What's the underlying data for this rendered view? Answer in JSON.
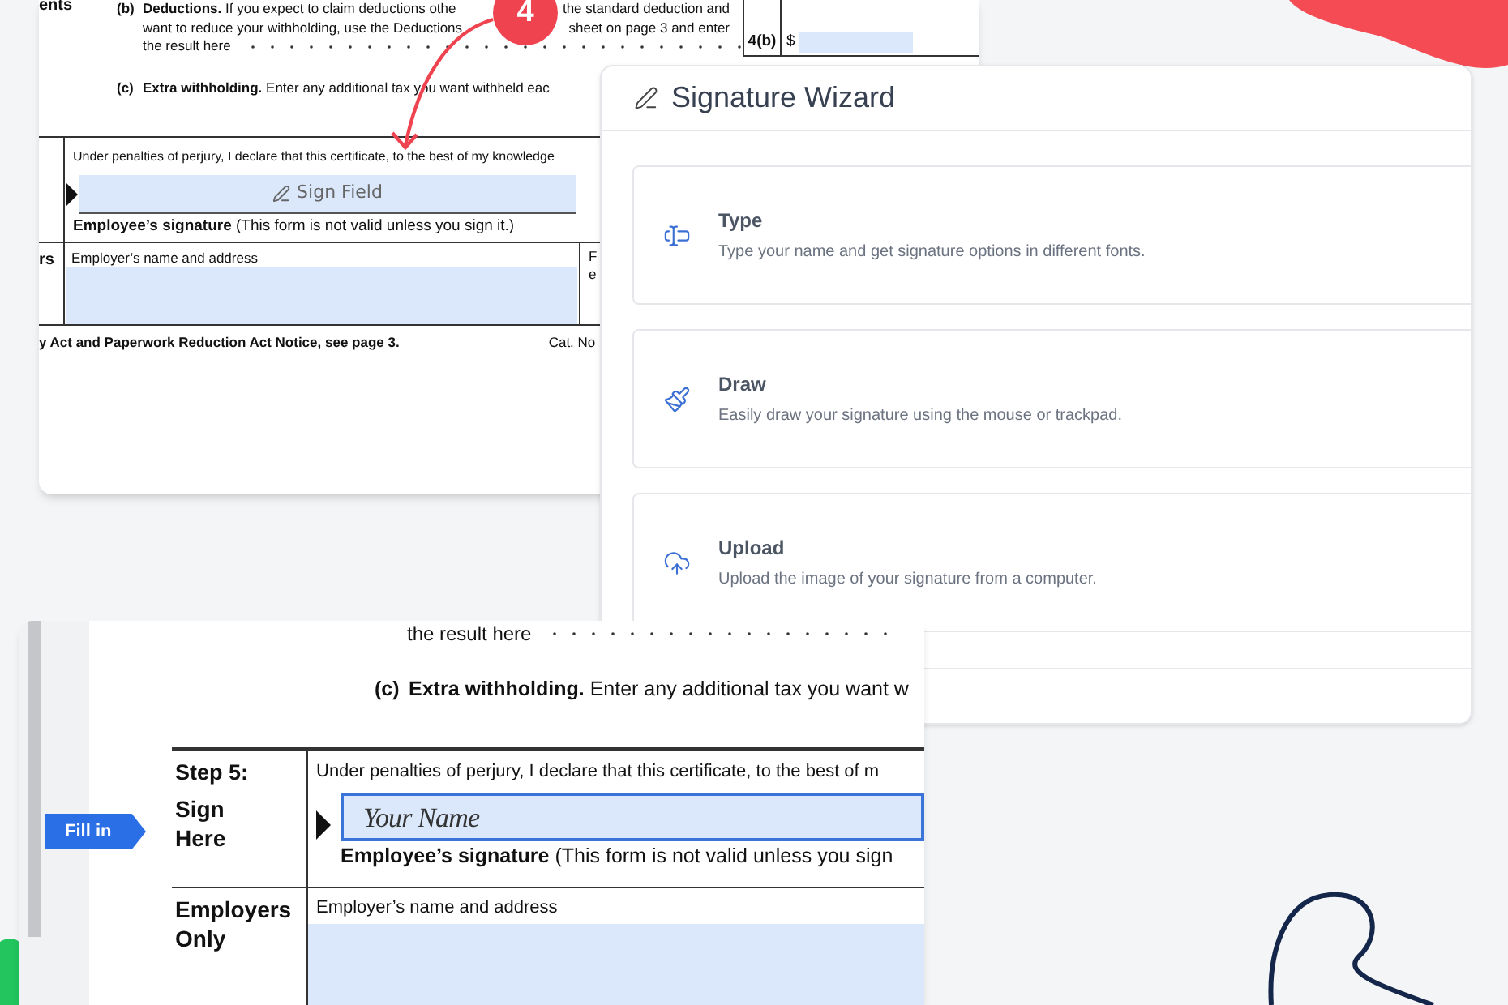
{
  "form_top": {
    "section_label": "ents",
    "deductions": {
      "marker": "(b)",
      "lines": [
        [
          "**Deductions.** If you expect to claim deductions othe",
          "the standard deduction and"
        ],
        [
          "want to reduce your withholding, use the Deductions",
          "sheet on page 3 and enter"
        ],
        [
          "the result here"
        ]
      ]
    },
    "line_4b": {
      "label": "4(b)",
      "currency": "$"
    },
    "extra": {
      "marker": "(c)",
      "text": "**Extra withholding.** Enter any additional tax you want withheld eac"
    },
    "perjury": "Under penalties of perjury, I declare that this certificate, to the best of my knowledge",
    "sign_field": {
      "label": "Sign Field"
    },
    "signature_caption": "**Employee’s signature** (This form is not valid unless you sign it.)",
    "employers_label": "rs",
    "employer_field_label": "Employer’s name and address",
    "column_2": [
      "F",
      "e"
    ],
    "footer": "y Act and Paperwork Reduction Act Notice, see page 3.",
    "footer_right": "Cat. No"
  },
  "step_badge": "4",
  "signature_wizard": {
    "title": "Signature Wizard",
    "options": [
      {
        "kind": "type",
        "title": "Type",
        "description": "Type your name and get signature options in different fonts."
      },
      {
        "kind": "draw",
        "title": "Draw",
        "description": "Easily draw your signature using the mouse or trackpad."
      },
      {
        "kind": "upload",
        "title": "Upload",
        "description": "Upload the image of your signature from a computer."
      }
    ]
  },
  "form_bottom": {
    "result_line": "the result here",
    "extra": {
      "marker": "(c)",
      "text": "**Extra withholding.** Enter any additional tax you want w"
    },
    "step_title": "Step 5:",
    "step_subtitle": "Sign Here",
    "perjury": "Under penalties of perjury, I declare that this certificate, to the best of m",
    "signature": {
      "value": "Your Name"
    },
    "signature_caption": "**Employee’s signature** (This form is not valid unless you sign",
    "employers_label": "Employers Only",
    "employer_field_label": "Employer’s name and address"
  },
  "fill_in_tag": "Fill in"
}
